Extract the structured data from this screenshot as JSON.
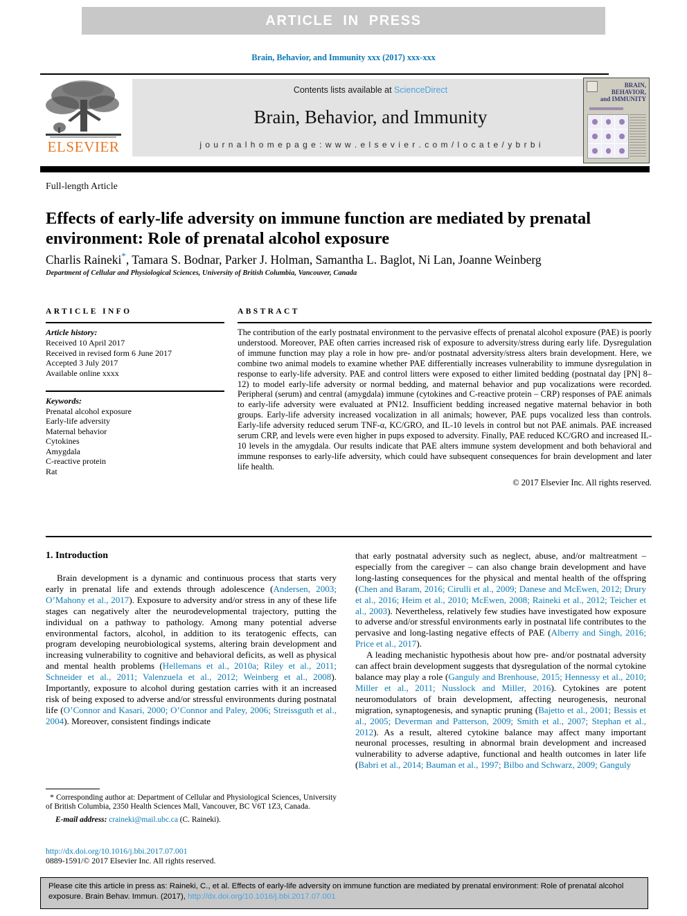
{
  "banner": {
    "text": "ARTICLE  IN  PRESS",
    "background_color": "#c8c8c8",
    "text_color": "#ffffff"
  },
  "running_head": "Brain, Behavior, and Immunity xxx (2017) xxx-xxx",
  "masthead": {
    "publisher_wordmark": "ELSEVIER",
    "contents_prefix": "Contents lists available at ",
    "contents_link": "ScienceDirect",
    "journal_title": "Brain, Behavior, and Immunity",
    "homepage": "j o u r n a l   h o m e p a g e :   w w w . e l s e v i e r . c o m / l o c a t e / y b r b i",
    "cover_title_lines": [
      "BRAIN,",
      "BEHAVIOR,",
      "and IMMUNITY"
    ]
  },
  "article": {
    "kicker": "Full-length Article",
    "title": "Effects of early-life adversity on immune function are mediated by prenatal environment: Role of prenatal alcohol exposure",
    "authors": "Charlis Raineki, Tamara S. Bodnar, Parker J. Holman, Samantha L. Baglot, Ni Lan, Joanne Weinberg",
    "authors_lead": "Charlis Raineki",
    "authors_rest": ", Tamara S. Bodnar, Parker J. Holman, Samantha L. Baglot, Ni Lan, Joanne Weinberg",
    "corresponding_marker": "*",
    "affiliation": "Department of Cellular and Physiological Sciences, University of British Columbia, Vancouver, Canada"
  },
  "info": {
    "heading": "ARTICLE INFO",
    "history_label": "Article history:",
    "history": [
      "Received 10 April 2017",
      "Received in revised form 6 June 2017",
      "Accepted 3 July 2017",
      "Available online xxxx"
    ],
    "keywords_label": "Keywords:",
    "keywords": [
      "Prenatal alcohol exposure",
      "Early-life adversity",
      "Maternal behavior",
      "Cytokines",
      "Amygdala",
      "C-reactive protein",
      "Rat"
    ]
  },
  "abstract": {
    "heading": "ABSTRACT",
    "body": "The contribution of the early postnatal environment to the pervasive effects of prenatal alcohol exposure (PAE) is poorly understood. Moreover, PAE often carries increased risk of exposure to adversity/stress during early life. Dysregulation of immune function may play a role in how pre- and/or postnatal adversity/stress alters brain development. Here, we combine two animal models to examine whether PAE differentially increases vulnerability to immune dysregulation in response to early-life adversity. PAE and control litters were exposed to either limited bedding (postnatal day [PN] 8–12) to model early-life adversity or normal bedding, and maternal behavior and pup vocalizations were recorded. Peripheral (serum) and central (amygdala) immune (cytokines and C-reactive protein – CRP) responses of PAE animals to early-life adversity were evaluated at PN12. Insufficient bedding increased negative maternal behavior in both groups. Early-life adversity increased vocalization in all animals; however, PAE pups vocalized less than controls. Early-life adversity reduced serum TNF-α, KC/GRO, and IL-10 levels in control but not PAE animals. PAE increased serum CRP, and levels were even higher in pups exposed to adversity. Finally, PAE reduced KC/GRO and increased IL-10 levels in the amygdala. Our results indicate that PAE alters immune system development and both behavioral and immune responses to early-life adversity, which could have subsequent consequences for brain development and later life health.",
    "copyright": "© 2017 Elsevier Inc. All rights reserved."
  },
  "body": {
    "section_title": "1. Introduction",
    "left_paragraphs": [
      {
        "runs": [
          {
            "t": "Brain development is a dynamic and continuous process that starts very early in prenatal life and extends through adolescence ("
          },
          {
            "t": "Andersen, 2003; O’Mahony et al., 2017",
            "cite": true
          },
          {
            "t": "). Exposure to adversity and/or stress in any of these life stages can negatively alter the neurodevelopmental trajectory, putting the individual on a pathway to pathology. Among many potential adverse environmental factors, alcohol, in addition to its teratogenic effects, can program developing neurobiological systems, altering brain development and increasing vulnerability to cognitive and behavioral deficits, as well as physical and mental health problems ("
          },
          {
            "t": "Hellemans et al., 2010a; Riley et al., 2011; Schneider et al., 2011; Valenzuela et al., 2012; Weinberg et al., 2008",
            "cite": true
          },
          {
            "t": "). Importantly, exposure to alcohol during gestation carries with it an increased risk of being exposed to adverse and/or stressful environments during postnatal life ("
          },
          {
            "t": "O’Connor and Kasari, 2000; O’Connor and Paley, 2006; Streissguth et al., 2004",
            "cite": true
          },
          {
            "t": "). Moreover, consistent findings indicate"
          }
        ]
      }
    ],
    "right_paragraphs": [
      {
        "noindent": true,
        "runs": [
          {
            "t": "that early postnatal adversity such as neglect, abuse, and/or maltreatment – especially from the caregiver – can also change brain development and have long-lasting consequences for the physical and mental health of the offspring ("
          },
          {
            "t": "Chen and Baram, 2016; Cirulli et al., 2009; Danese and McEwen, 2012; Drury et al., 2016; Heim et al., 2010; McEwen, 2008; Raineki et al., 2012; Teicher et al., 2003",
            "cite": true
          },
          {
            "t": "). Nevertheless, relatively few studies have investigated how exposure to adverse and/or stressful environments early in postnatal life contributes to the pervasive and long-lasting negative effects of PAE ("
          },
          {
            "t": "Alberry and Singh, 2016; Price et al., 2017",
            "cite": true
          },
          {
            "t": ")."
          }
        ]
      },
      {
        "noindent": false,
        "runs": [
          {
            "t": "A leading mechanistic hypothesis about how pre- and/or postnatal adversity can affect brain development suggests that dysregulation of the normal cytokine balance may play a role ("
          },
          {
            "t": "Ganguly and Brenhouse, 2015; Hennessy et al., 2010; Miller et al., 2011; Nusslock and Miller, 2016",
            "cite": true
          },
          {
            "t": "). Cytokines are potent neuromodulators of brain development, affecting neurogenesis, neuronal migration, synaptogenesis, and synaptic pruning ("
          },
          {
            "t": "Bajetto et al., 2001; Bessis et al., 2005; Deverman and Patterson, 2009; Smith et al., 2007; Stephan et al., 2012",
            "cite": true
          },
          {
            "t": "). As a result, altered cytokine balance may affect many important neuronal processes, resulting in abnormal brain development and increased vulnerability to adverse adaptive, functional and health outcomes in later life ("
          },
          {
            "t": "Babri et al., 2014; Bauman et al., 1997; Bilbo and Schwarz, 2009; Ganguly",
            "cite": true
          }
        ]
      }
    ]
  },
  "footnote": {
    "marker": "*",
    "corresponding": "Corresponding author at: Department of Cellular and Physiological Sciences, University of British Columbia, 2350 Health Sciences Mall, Vancouver, BC V6T 1Z3, Canada.",
    "email_label": "E-mail address:",
    "email": "craineki@mail.ubc.ca",
    "email_suffix": "(C. Raineki)."
  },
  "issn": {
    "doi_url": "http://dx.doi.org/10.1016/j.bbi.2017.07.001",
    "line": "0889-1591/© 2017 Elsevier Inc. All rights reserved."
  },
  "cite_box": {
    "prefix": "Please cite this article in press as: Raineki, C., et al. Effects of early-life adversity on immune function are mediated by prenatal environment: Role of prenatal alcohol exposure. Brain Behav. Immun. (2017), ",
    "doi": "http://dx.doi.org/10.1016/j.bbi.2017.07.001",
    "background_color": "#c8c8c8"
  },
  "colors": {
    "link": "#0b7ab5",
    "sciencedirect": "#4aa3df",
    "elsevier_orange": "#e87722",
    "band_grey": "#c8c8c8",
    "journal_box_grey": "#e3e3e3"
  }
}
